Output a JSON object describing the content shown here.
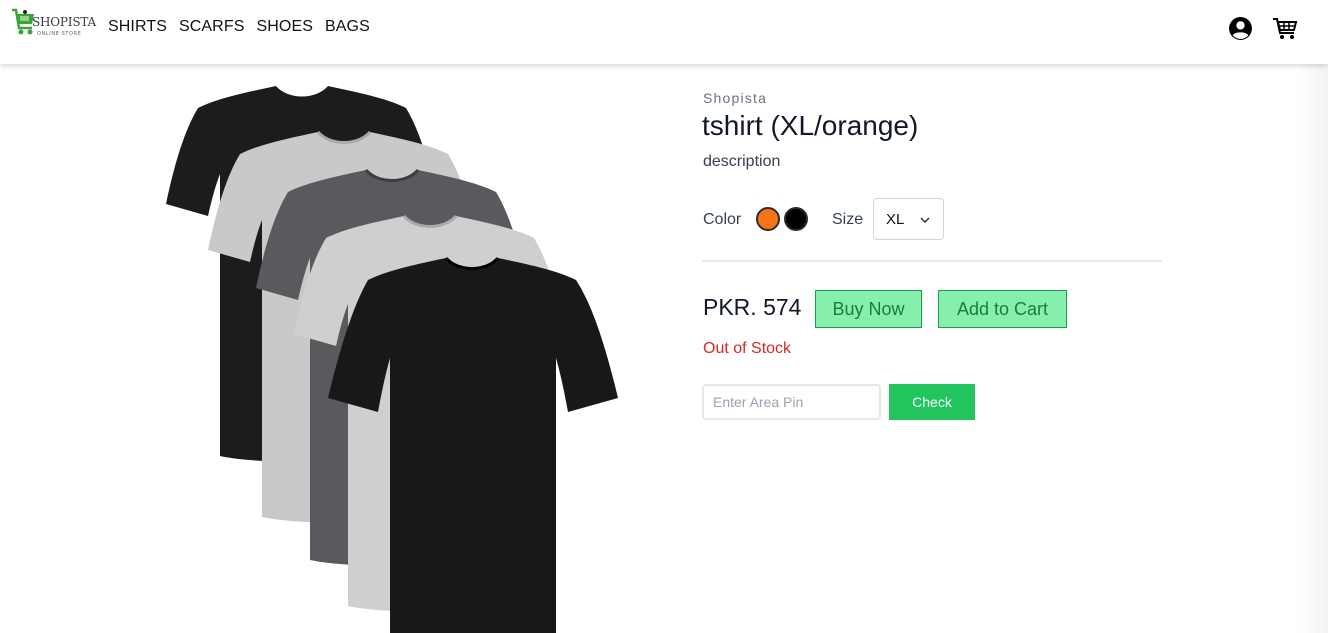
{
  "header": {
    "logo_text": "SHOPISTA",
    "logo_subtext": "ONLINE STORE",
    "nav": [
      {
        "label": "SHIRTS"
      },
      {
        "label": "SCARFS"
      },
      {
        "label": "SHOES"
      },
      {
        "label": "BAGS"
      }
    ],
    "icons": {
      "account": "account-circle-icon",
      "cart": "shopping-cart-icon"
    }
  },
  "product": {
    "brand": "Shopista",
    "title": "tshirt (XL/orange)",
    "description": "description",
    "color_label": "Color",
    "colors": [
      {
        "name": "orange",
        "hex": "#f97316",
        "selected": true
      },
      {
        "name": "black",
        "hex": "#000000",
        "selected": false
      }
    ],
    "size_label": "Size",
    "size_selected": "XL",
    "price": "PKR. 574",
    "buy_now_label": "Buy Now",
    "add_to_cart_label": "Add to Cart",
    "stock_status": "Out of Stock",
    "pin_placeholder": "Enter Area Pin",
    "check_label": "Check"
  },
  "colors": {
    "accent_green": "#22c55e",
    "button_green_light": "#86efac",
    "error_red": "#dc2626"
  }
}
